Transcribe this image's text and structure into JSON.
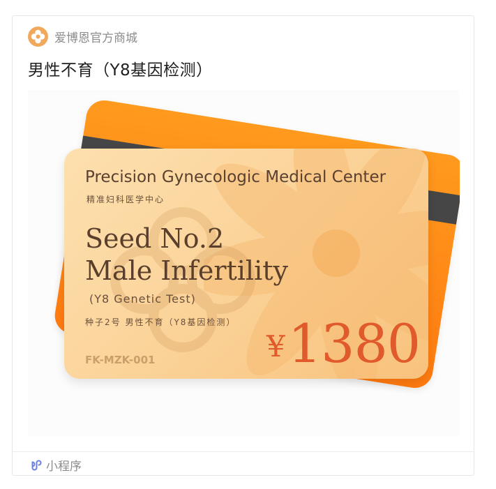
{
  "header": {
    "brand": "爱博恩官方商城",
    "logo_icon": "plum-blossom-logo-icon"
  },
  "title": "男性不育（Y8基因检测）",
  "card": {
    "center_name": "Precision Gynecologic Medical Center",
    "center_cn": "精准妇科医学中心",
    "line1": "Seed No.2",
    "line2": "Male Infertility",
    "genetic": "(Y8 Genetic Test)",
    "product_cn": "种子2号   男性不育（Y8基因检测）",
    "currency": "¥",
    "price": "1380",
    "code": "FK-MZK-001"
  },
  "footer": {
    "label": "小程序",
    "icon": "mini-program-icon"
  },
  "colors": {
    "accent_orange": "#ff8a14",
    "price_red": "#e05a2b",
    "card_cream": "#fbd49b"
  }
}
